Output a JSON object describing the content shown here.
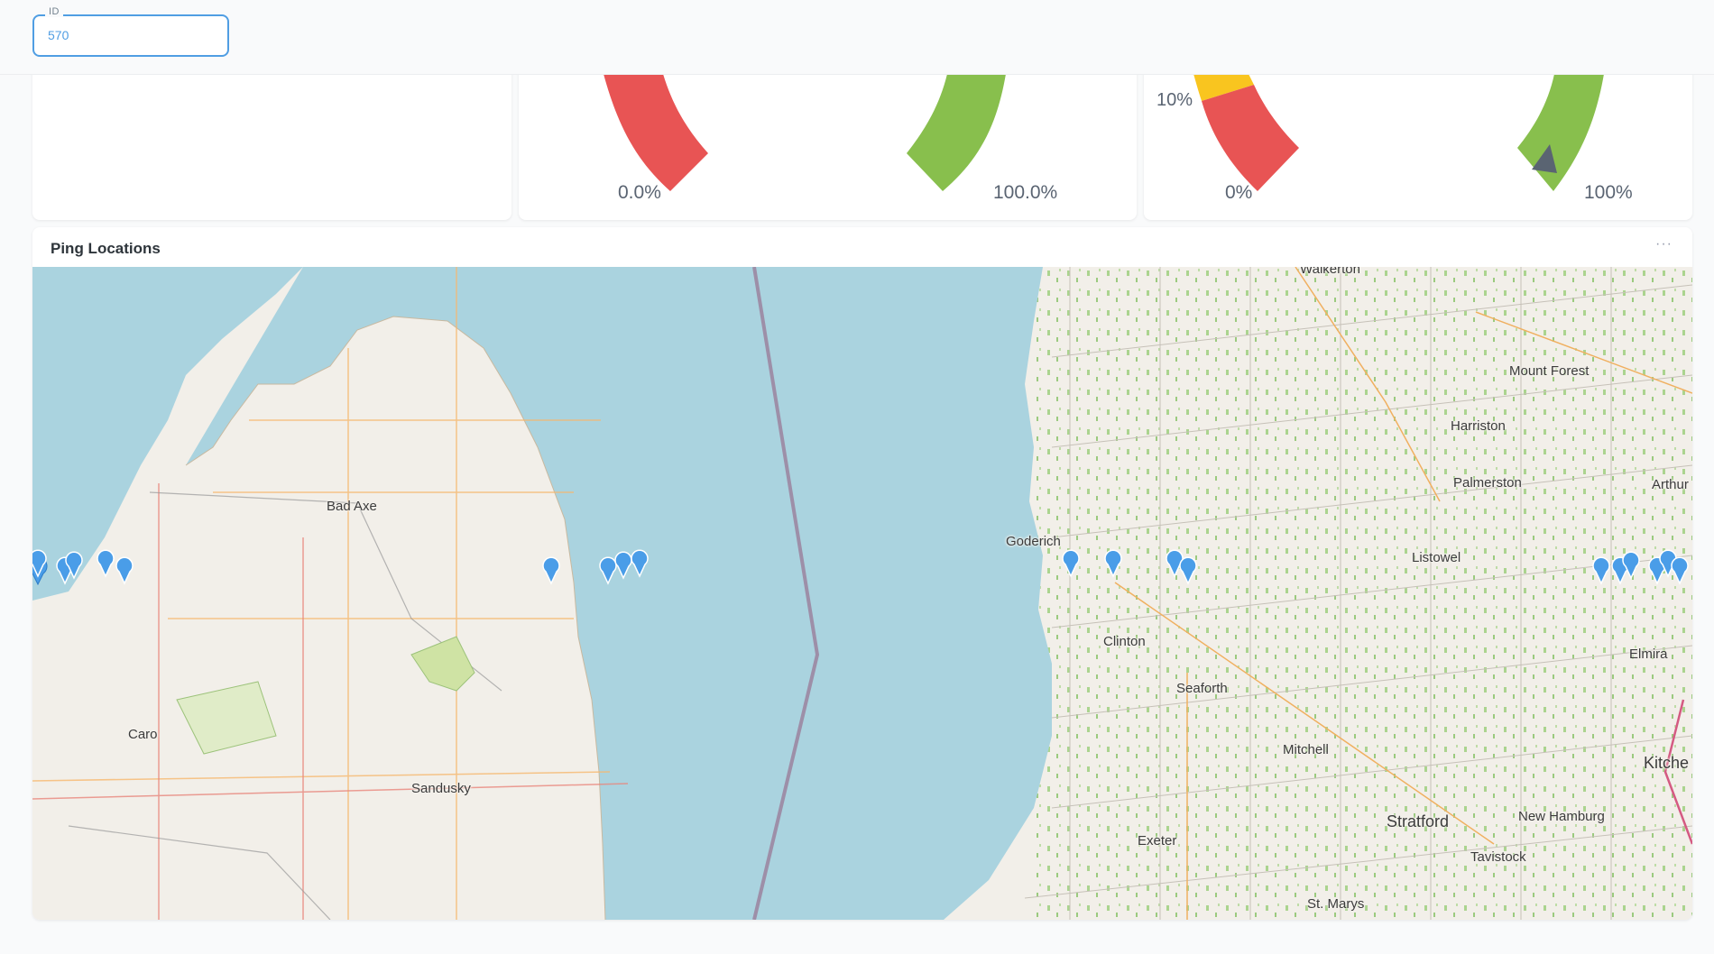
{
  "filter": {
    "label": "ID",
    "value": "570"
  },
  "gauge_a": {
    "min_label": "0.0%",
    "max_label": "100.0%",
    "colors": [
      "#e85454",
      "#88bf4d"
    ]
  },
  "gauge_b": {
    "min_label": "0%",
    "max_label": "100%",
    "mid_label": "10%",
    "colors": [
      "#e85454",
      "#f9c51f",
      "#88bf4d",
      "#5a6472"
    ]
  },
  "map_card": {
    "title": "Ping Locations",
    "menu_label": "···",
    "water_color": "#aad3df",
    "land_color": "#f2efe9",
    "pin_color": "#4a9de8",
    "cities": [
      {
        "name": "Bad Axe"
      },
      {
        "name": "Caro"
      },
      {
        "name": "Sandusky"
      },
      {
        "name": "Goderich"
      },
      {
        "name": "Clinton"
      },
      {
        "name": "Seaforth"
      },
      {
        "name": "Mitchell"
      },
      {
        "name": "Exeter"
      },
      {
        "name": "Stratford"
      },
      {
        "name": "St. Marys"
      },
      {
        "name": "Tavistock"
      },
      {
        "name": "New Hamburg"
      },
      {
        "name": "Kitche"
      },
      {
        "name": "Elmira"
      },
      {
        "name": "Listowel"
      },
      {
        "name": "Palmerston"
      },
      {
        "name": "Harriston"
      },
      {
        "name": "Mount Forest"
      },
      {
        "name": "Arthur"
      },
      {
        "name": "Walkerton"
      }
    ]
  }
}
